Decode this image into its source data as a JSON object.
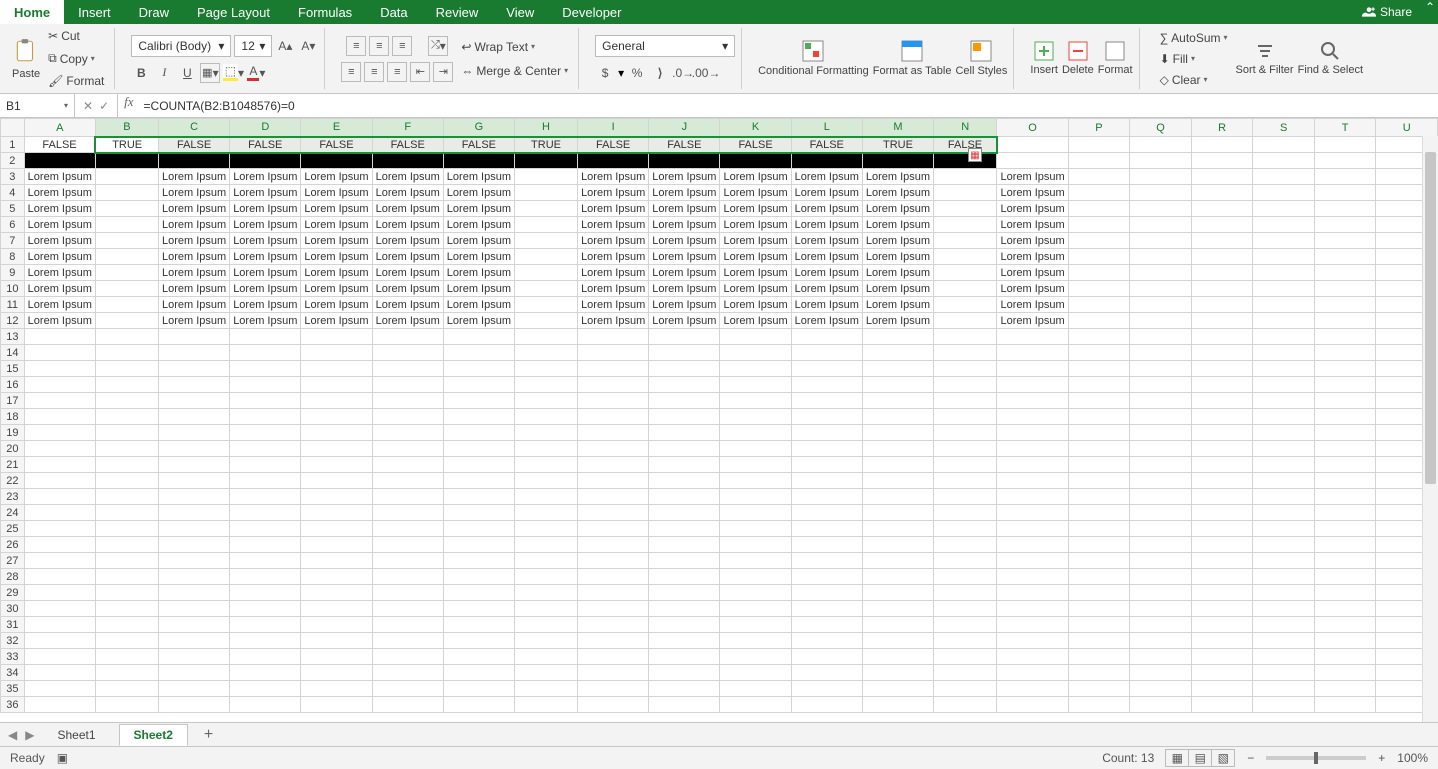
{
  "tabs": {
    "items": [
      "Home",
      "Insert",
      "Draw",
      "Page Layout",
      "Formulas",
      "Data",
      "Review",
      "View",
      "Developer"
    ],
    "active": 0,
    "share": "Share"
  },
  "ribbon": {
    "clipboard": {
      "paste": "Paste",
      "cut": "Cut",
      "copy": "Copy",
      "format": "Format"
    },
    "font": {
      "name": "Calibri (Body)",
      "size": "12",
      "bold": "B",
      "italic": "I",
      "underline": "U"
    },
    "alignment": {
      "wrap": "Wrap Text",
      "merge": "Merge & Center"
    },
    "number": {
      "format": "General",
      "currency": "$",
      "percent": "%",
      "comma": ","
    },
    "styles": {
      "cf": "Conditional\nFormatting",
      "fat": "Format\nas Table",
      "cs": "Cell\nStyles"
    },
    "cells": {
      "insert": "Insert",
      "delete": "Delete",
      "format": "Format"
    },
    "editing": {
      "autosum": "AutoSum",
      "fill": "Fill",
      "clear": "Clear",
      "sort": "Sort &\nFilter",
      "find": "Find &\nSelect"
    }
  },
  "namebox": "B1",
  "formula": "=COUNTA(B2:B1048576)=0",
  "columns": [
    "A",
    "B",
    "C",
    "D",
    "E",
    "F",
    "G",
    "H",
    "I",
    "J",
    "K",
    "L",
    "M",
    "N",
    "O",
    "P",
    "Q",
    "R",
    "S",
    "T",
    "U"
  ],
  "row1": [
    "",
    "FALSE",
    "TRUE",
    "FALSE",
    "FALSE",
    "FALSE",
    "FALSE",
    "FALSE",
    "TRUE",
    "FALSE",
    "FALSE",
    "FALSE",
    "FALSE",
    "TRUE",
    "FALSE",
    "",
    "",
    "",
    "",
    "",
    "",
    ""
  ],
  "lorem": "Lorem Ipsum",
  "data_present_cols": [
    1,
    0,
    1,
    1,
    1,
    1,
    1,
    0,
    1,
    1,
    1,
    1,
    1,
    0,
    1
  ],
  "data_rows": [
    3,
    4,
    5,
    6,
    7,
    8,
    9,
    10,
    11,
    12
  ],
  "total_rows": 36,
  "sheets": {
    "items": [
      "Sheet1",
      "Sheet2"
    ],
    "active": 1
  },
  "status": {
    "ready": "Ready",
    "count": "Count: 13",
    "zoom": "100%"
  }
}
